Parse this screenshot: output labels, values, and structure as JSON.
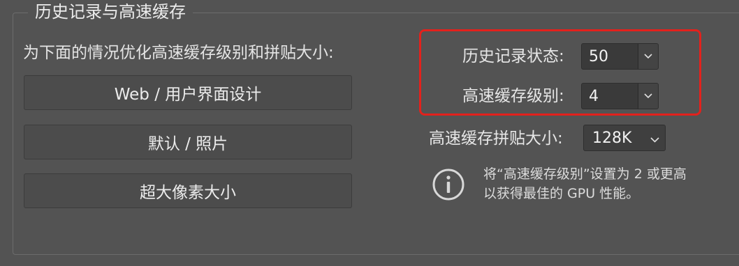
{
  "group": {
    "title": "历史记录与高速缓存"
  },
  "optimize": {
    "label": "为下面的情况优化高速缓存级别和拼贴大小:",
    "buttons": [
      "Web / 用户界面设计",
      "默认 / 照片",
      "超大像素大小"
    ]
  },
  "history_states": {
    "label": "历史记录状态:",
    "value": "50"
  },
  "cache_levels": {
    "label": "高速缓存级别:",
    "value": "4"
  },
  "tile_size": {
    "label": "高速缓存拼贴大小:",
    "value": "128K"
  },
  "info": {
    "line1": "将“高速缓存级别”设置为 2 或更高",
    "line2": "以获得最佳的 GPU 性能。"
  },
  "colors": {
    "highlight": "#e3211c",
    "panel": "#535353"
  }
}
